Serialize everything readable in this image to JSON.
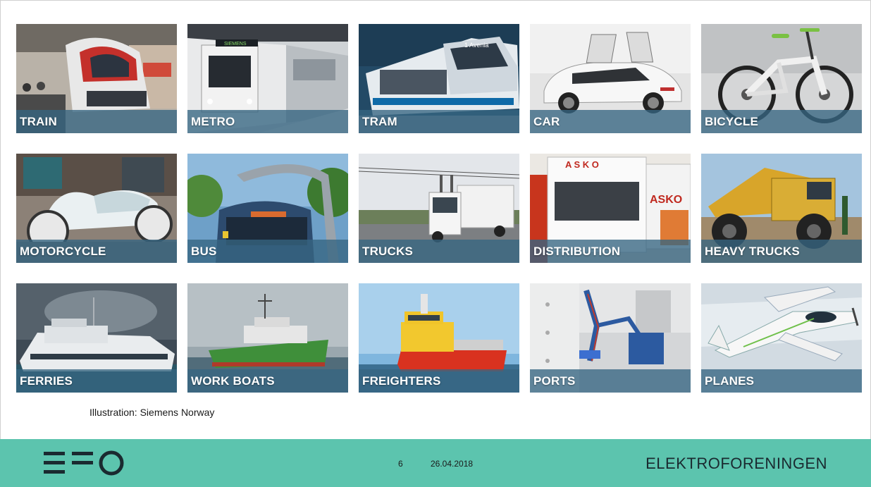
{
  "slide": {
    "tiles": [
      {
        "label": "TRAIN",
        "image": "electric-train-photo"
      },
      {
        "label": "METRO",
        "image": "metro-train-photo"
      },
      {
        "label": "TRAM",
        "image": "tram-photo"
      },
      {
        "label": "CAR",
        "image": "electric-car-photo"
      },
      {
        "label": "BICYCLE",
        "image": "electric-bicycle-photo"
      },
      {
        "label": "MOTORCYCLE",
        "image": "electric-motorcycle-photo"
      },
      {
        "label": "BUS",
        "image": "electric-bus-photo"
      },
      {
        "label": "TRUCKS",
        "image": "electric-truck-photo"
      },
      {
        "label": "DISTRIBUTION",
        "image": "distribution-truck-photo"
      },
      {
        "label": "HEAVY TRUCKS",
        "image": "mining-truck-photo"
      },
      {
        "label": "FERRIES",
        "image": "ferry-photo"
      },
      {
        "label": "WORK BOATS",
        "image": "work-boat-photo"
      },
      {
        "label": "FREIGHTERS",
        "image": "freighter-ship-photo"
      },
      {
        "label": "PORTS",
        "image": "port-charging-photo"
      },
      {
        "label": "PLANES",
        "image": "electric-plane-photo"
      }
    ],
    "caption": "Illustration: Siemens Norway"
  },
  "footer": {
    "logo": "EFO",
    "page_number": "6",
    "date": "26.04.2018",
    "organization": "ELEKTROFORENINGEN"
  },
  "colors": {
    "footer_bg": "#5cc4ae",
    "label_band": "#366582"
  }
}
